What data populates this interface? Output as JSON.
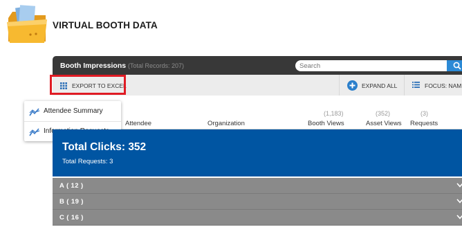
{
  "header": {
    "page_title": "VIRTUAL BOOTH DATA",
    "icon": "folder-icon"
  },
  "panel": {
    "title": "Booth Impressions",
    "record_count": "(Total Records: 207)",
    "search_placeholder": "Search",
    "search_icon": "search-icon"
  },
  "toolbar": {
    "export_label": "EXPORT TO EXCEL",
    "expand_label": "EXPAND ALL",
    "focus_label": "FOCUS: NAME"
  },
  "menu": {
    "items": [
      {
        "label": "Attendee Summary",
        "icon": "chart-line-icon"
      },
      {
        "label": "Information Requests",
        "icon": "chart-line-icon"
      }
    ]
  },
  "columns": {
    "attendee": "Attendee",
    "organization": "Organization",
    "booth_views": {
      "label": "Booth Views",
      "count": "(1,183)"
    },
    "asset_views": {
      "label": "Asset Views",
      "count": "(352)"
    },
    "requests": {
      "label": "Requests",
      "count": "(3)"
    }
  },
  "summary": {
    "total_clicks": "Total Clicks: 352",
    "total_requests": "Total Requests: 3"
  },
  "groups": [
    {
      "label": "A ( 12 )"
    },
    {
      "label": "B ( 19 )"
    },
    {
      "label": "C ( 16 )"
    }
  ],
  "colors": {
    "title_bar": "#383838",
    "summary_blue": "#0055a2",
    "group_gray": "#8a8a8a",
    "accent_blue": "#2b8ad6",
    "highlight_red": "#e01b24"
  }
}
